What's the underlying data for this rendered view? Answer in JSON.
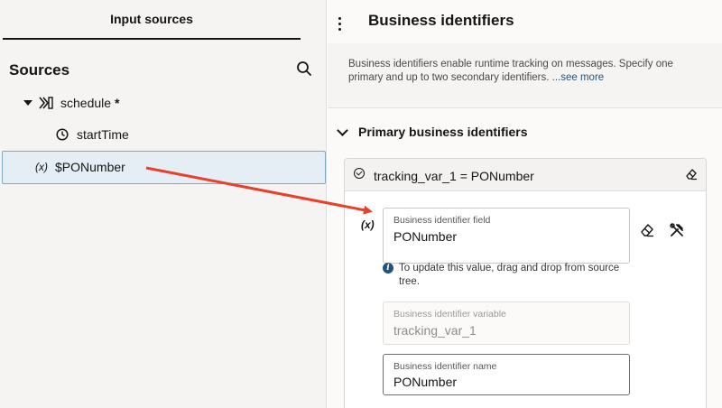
{
  "left_panel": {
    "tab_label": "Input sources",
    "sources_title": "Sources",
    "tree": {
      "schedule": {
        "label": "schedule",
        "required_mark": "*"
      },
      "start_time": {
        "label": "startTime"
      },
      "po_number": {
        "var_marker": "(x)",
        "label": "$PONumber"
      }
    }
  },
  "right_panel": {
    "title": "Business identifiers",
    "description": "Business identifiers enable runtime tracking on messages. Specify one primary and up to two secondary identifiers.",
    "see_more": "...see more",
    "section_title": "Primary business identifiers",
    "card": {
      "header": "tracking_var_1 = PONumber",
      "var_marker": "(x)",
      "field_label": "Business identifier field",
      "field_value": "PONumber",
      "info_text": "To update this value, drag and drop from source tree.",
      "variable_label": "Business identifier variable",
      "variable_value": "tracking_var_1",
      "name_label": "Business identifier name",
      "name_value": "PONumber"
    }
  },
  "colors": {
    "arrow": "#e8402a",
    "selection_bg": "#e4eef4",
    "link": "#23527c"
  },
  "icons": [
    "search-icon",
    "chevron-down-icon",
    "schedule-icon",
    "clock-icon",
    "kebab-icon",
    "check-circle-icon",
    "eraser-icon",
    "tools-icon",
    "info-icon"
  ]
}
